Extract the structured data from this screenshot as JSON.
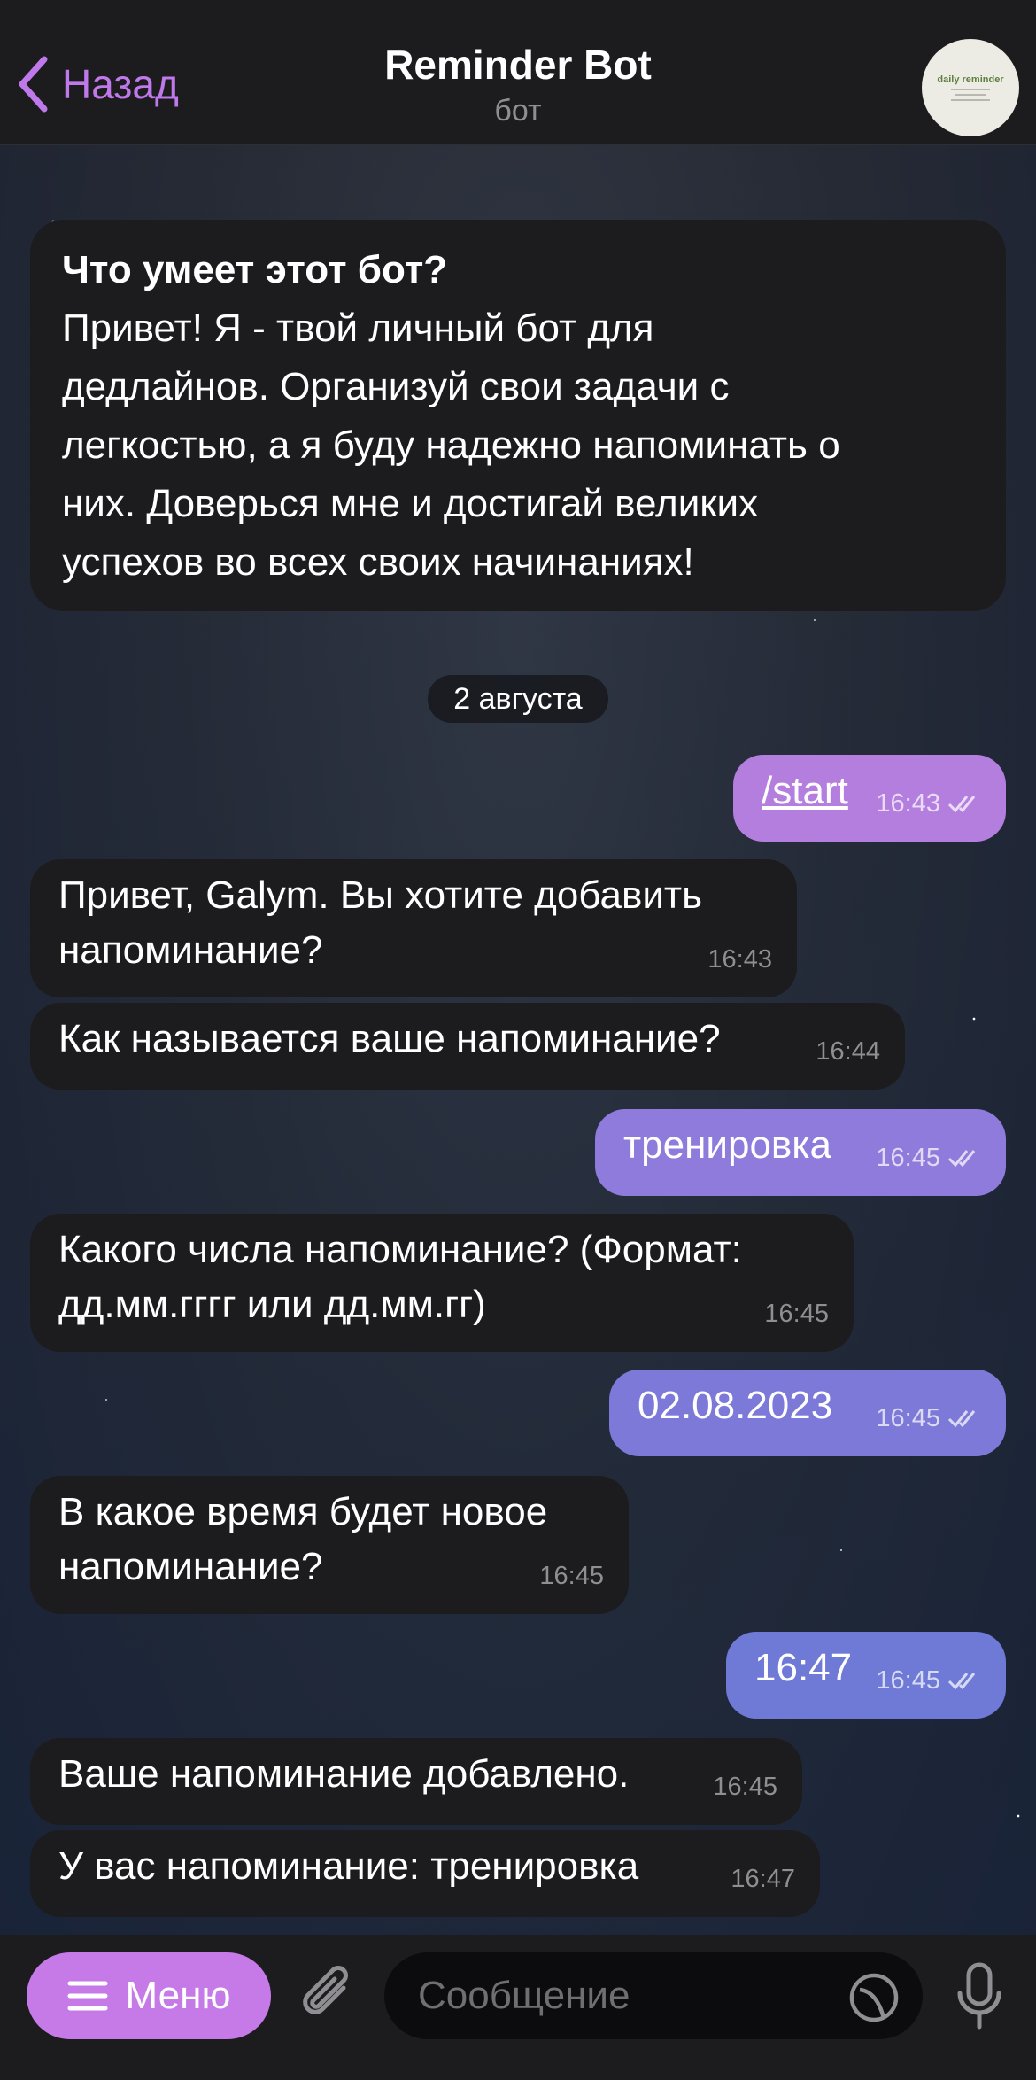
{
  "header": {
    "back_label": "Назад",
    "title": "Reminder Bot",
    "subtitle": "бот",
    "avatar_text": "daily reminder"
  },
  "intro": {
    "title": "Что умеет этот бот?",
    "lines": [
      "Привет! Я - твой личный бот для",
      "дедлайнов. Организуй свои задачи с",
      "легкостью, а я буду надежно напоминать о",
      "них. Доверься мне и достигай великих",
      "успехов во всех своих начинаниях!"
    ]
  },
  "date_divider": "2 августа",
  "messages": [
    {
      "side": "out",
      "text": "/start",
      "time": "16:43",
      "read": true
    },
    {
      "side": "in",
      "lines": [
        "Привет, Galym. Вы хотите добавить",
        "напоминание?"
      ],
      "time": "16:43"
    },
    {
      "side": "in",
      "lines": [
        "Как называется ваше напоминание?"
      ],
      "time": "16:44"
    },
    {
      "side": "out",
      "text": "тренировка",
      "time": "16:45",
      "read": true
    },
    {
      "side": "in",
      "lines": [
        "Какого числа напоминание? (Формат:",
        "дд.мм.гггг или дд.мм.гг)"
      ],
      "time": "16:45"
    },
    {
      "side": "out",
      "text": "02.08.2023",
      "time": "16:45",
      "read": true
    },
    {
      "side": "in",
      "lines": [
        "В какое время будет новое",
        "напоминание?"
      ],
      "time": "16:45"
    },
    {
      "side": "out",
      "text": "16:47",
      "time": "16:45",
      "read": true
    },
    {
      "side": "in",
      "lines": [
        "Ваше напоминание добавлено."
      ],
      "time": "16:45"
    },
    {
      "side": "in",
      "lines": [
        "У вас напоминание: тренировка"
      ],
      "time": "16:47"
    }
  ],
  "input": {
    "menu_label": "Меню",
    "placeholder": "Сообщение"
  },
  "colors": {
    "accent": "#c079ea",
    "outgoing_top": "#b77fdf",
    "outgoing_bottom": "#6b79d4",
    "incoming": "#1c1c1e"
  }
}
